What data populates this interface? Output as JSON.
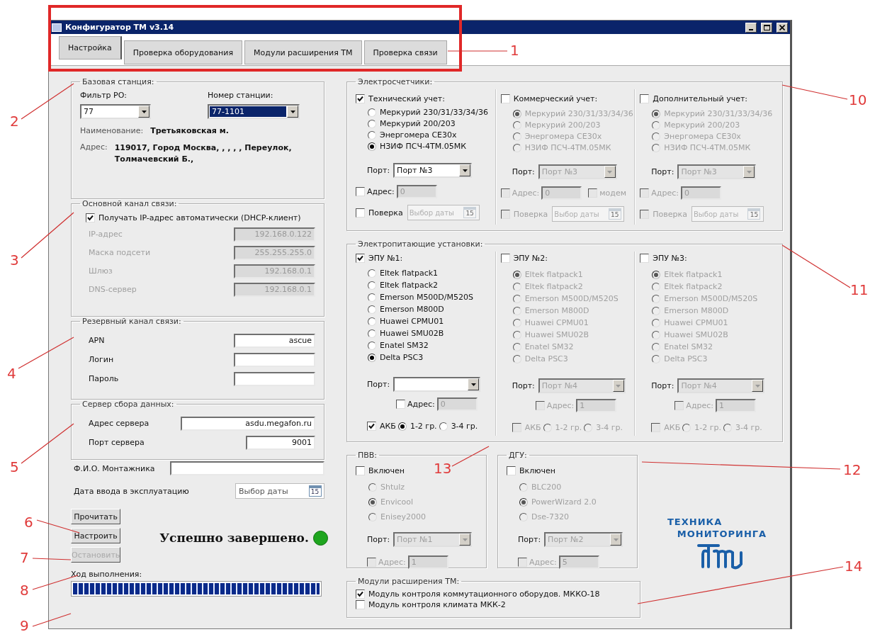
{
  "window": {
    "title": "Конфигуратор ТМ v3.14"
  },
  "tabs": [
    {
      "label": "Настройка",
      "selected": true
    },
    {
      "label": "Проверка оборудования",
      "selected": false
    },
    {
      "label": "Модули расширения ТМ",
      "selected": false
    },
    {
      "label": "Проверка связи",
      "selected": false
    }
  ],
  "base_station": {
    "title": "Базовая станция:",
    "filter_label": "Фильтр РО:",
    "filter_value": "77",
    "station_label": "Номер станции:",
    "station_value": "77-1101",
    "name_label": "Наименование:",
    "name_value": "Третьяковская м.",
    "address_label": "Адрес:",
    "address_value": "119017, Город Москва, , , , , Переулок, Толмачевский Б.,"
  },
  "main_channel": {
    "title": "Основной канал связи:",
    "dhcp": {
      "label": "Получать IP-адрес автоматически (DHCP-клиент)",
      "checked": true
    },
    "fields": [
      {
        "label": "IP-адрес",
        "value": "192.168.0.122"
      },
      {
        "label": "Маска подсети",
        "value": "255.255.255.0"
      },
      {
        "label": "Шлюз",
        "value": "192.168.0.1"
      },
      {
        "label": "DNS-сервер",
        "value": "192.168.0.1"
      }
    ]
  },
  "backup_channel": {
    "title": "Резервный канал связи:",
    "fields": [
      {
        "label": "APN",
        "value": "ascue"
      },
      {
        "label": "Логин"
      },
      {
        "label": "Пароль"
      }
    ]
  },
  "data_server": {
    "title": "Сервер сбора данных:",
    "fields": [
      {
        "label": "Адрес сервера",
        "value": "asdu.megafon.ru"
      },
      {
        "label": "Порт сервера",
        "value": "9001"
      }
    ]
  },
  "installer": {
    "label": "Ф.И.О. Монтажника"
  },
  "commission_date": {
    "label": "Дата ввода в эксплуатацию",
    "placeholder": "Выбор даты",
    "calendar_day": "15"
  },
  "buttons": [
    {
      "label": "Прочитать",
      "disabled": false
    },
    {
      "label": "Настроить",
      "disabled": false
    },
    {
      "label": "Остановить",
      "disabled": true
    }
  ],
  "status": {
    "text": "Успешно завершено."
  },
  "progress": {
    "label": "Ход выполнения:",
    "level": 1
  },
  "meters": {
    "title": "Электросчетчики:",
    "columns": [
      {
        "label": "Технический учет:",
        "checked": true,
        "options": [
          {
            "label": "Меркурий 230/31/33/34/36",
            "selected": false
          },
          {
            "label": "Меркурий 200/203",
            "selected": false
          },
          {
            "label": "Энергомера СЕ30х",
            "selected": false
          },
          {
            "label": "НЗИФ ПСЧ-4ТМ.05МК",
            "selected": true
          }
        ],
        "port_label": "Порт:",
        "port_value": "Порт №3",
        "address_label": "Адрес:",
        "address_checked": false,
        "address_value": "0",
        "verify_label": "Поверка",
        "verify_checked": false,
        "date_placeholder": "Выбор даты",
        "calendar_day": "15"
      },
      {
        "label": "Коммерческий учет:",
        "checked": false,
        "options": [
          {
            "label": "Меркурий 230/31/33/34/36",
            "selected": true
          },
          {
            "label": "Меркурий 200/203",
            "selected": false
          },
          {
            "label": "Энергомера СЕ30х",
            "selected": false
          },
          {
            "label": "НЗИФ ПСЧ-4ТМ.05МК",
            "selected": false
          }
        ],
        "port_label": "Порт:",
        "port_value": "Порт №3",
        "address_label": "Адрес:",
        "address_checked": false,
        "address_value": "0",
        "modem_label": "модем",
        "modem_checked": false,
        "verify_label": "Поверка",
        "verify_checked": false,
        "date_placeholder": "Выбор даты",
        "calendar_day": "15"
      },
      {
        "label": "Дополнительный учет:",
        "checked": false,
        "options": [
          {
            "label": "Меркурий 230/31/33/34/36",
            "selected": true
          },
          {
            "label": "Меркурий 200/203",
            "selected": false
          },
          {
            "label": "Энергомера СЕ30х",
            "selected": false
          },
          {
            "label": "НЗИФ ПСЧ-4ТМ.05МК",
            "selected": false
          }
        ],
        "port_label": "Порт:",
        "port_value": "Порт №3",
        "address_label": "Адрес:",
        "address_checked": false,
        "address_value": "0",
        "verify_label": "Поверка",
        "verify_checked": false,
        "date_placeholder": "Выбор даты",
        "calendar_day": "15"
      }
    ]
  },
  "power_units": {
    "title": "Электропитающие установки:",
    "columns": [
      {
        "label": "ЭПУ №1:",
        "checked": true,
        "options": [
          {
            "label": "Eltek flatpack1",
            "selected": false
          },
          {
            "label": "Eltek flatpack2",
            "selected": false
          },
          {
            "label": "Emerson M500D/M520S",
            "selected": false
          },
          {
            "label": "Emerson M800D",
            "selected": false
          },
          {
            "label": "Huawei CPMU01",
            "selected": false
          },
          {
            "label": "Huawei SMU02B",
            "selected": false
          },
          {
            "label": "Enatel SM32",
            "selected": false
          },
          {
            "label": "Delta PSC3",
            "selected": true
          }
        ],
        "port_label": "Порт:",
        "address_label": "Адрес:",
        "address_checked": false,
        "address_value": "0",
        "akb_label": "АКБ",
        "akb_checked": true,
        "groups": [
          {
            "label": "1-2 гр.",
            "selected": true
          },
          {
            "label": "3-4 гр.",
            "selected": false
          }
        ]
      },
      {
        "label": "ЭПУ №2:",
        "checked": false,
        "options": [
          {
            "label": "Eltek flatpack1",
            "selected": true
          },
          {
            "label": "Eltek flatpack2",
            "selected": false
          },
          {
            "label": "Emerson M500D/M520S",
            "selected": false
          },
          {
            "label": "Emerson M800D",
            "selected": false
          },
          {
            "label": "Huawei CPMU01",
            "selected": false
          },
          {
            "label": "Huawei SMU02B",
            "selected": false
          },
          {
            "label": "Enatel SM32",
            "selected": false
          },
          {
            "label": "Delta PSC3",
            "selected": false
          }
        ],
        "port_label": "Порт:",
        "port_value": "Порт №4",
        "address_label": "Адрес:",
        "address_checked": false,
        "address_value": "1",
        "akb_label": "АКБ",
        "akb_checked": false,
        "groups": [
          {
            "label": "1-2 гр.",
            "selected": false
          },
          {
            "label": "3-4 гр.",
            "selected": false
          }
        ]
      },
      {
        "label": "ЭПУ №3:",
        "checked": false,
        "options": [
          {
            "label": "Eltek flatpack1",
            "selected": true
          },
          {
            "label": "Eltek flatpack2",
            "selected": false
          },
          {
            "label": "Emerson M500D/M520S",
            "selected": false
          },
          {
            "label": "Emerson M800D",
            "selected": false
          },
          {
            "label": "Huawei CPMU01",
            "selected": false
          },
          {
            "label": "Huawei SMU02B",
            "selected": false
          },
          {
            "label": "Enatel SM32",
            "selected": false
          },
          {
            "label": "Delta PSC3",
            "selected": false
          }
        ],
        "port_label": "Порт:",
        "port_value": "Порт №4",
        "address_label": "Адрес:",
        "address_checked": false,
        "address_value": "1",
        "akb_label": "АКБ",
        "akb_checked": false,
        "groups": [
          {
            "label": "1-2 гр.",
            "selected": false
          },
          {
            "label": "3-4 гр.",
            "selected": false
          }
        ]
      }
    ]
  },
  "units": [
    {
      "title": "ПВВ:",
      "enabled_label": "Включен",
      "enabled_checked": false,
      "options": [
        {
          "label": "Shtulz",
          "selected": false
        },
        {
          "label": "Envicool",
          "selected": true
        },
        {
          "label": "Enisey2000",
          "selected": false
        }
      ],
      "port_label": "Порт:",
      "port_value": "Порт №1",
      "address_label": "Адрес:",
      "address_checked": false,
      "address_value": "1"
    },
    {
      "title": "ДГУ:",
      "enabled_label": "Включен",
      "enabled_checked": false,
      "options": [
        {
          "label": "BLC200",
          "selected": false
        },
        {
          "label": "PowerWizard 2.0",
          "selected": true
        },
        {
          "label": "Dse-7320",
          "selected": false
        }
      ],
      "port_label": "Порт:",
      "port_value": "Порт №2",
      "address_label": "Адрес:",
      "address_checked": false,
      "address_value": "5"
    }
  ],
  "modules": {
    "title": "Модули расширения ТМ:",
    "items": [
      {
        "label": "Модуль контроля коммутационного оборудов. МККО-18",
        "checked": true
      },
      {
        "label": "Модуль контроля климата МКК-2",
        "checked": false
      }
    ]
  },
  "logo": {
    "line_1": "ТЕХНИКА",
    "line_2": "МОНИТОРИНГА"
  },
  "annotations": [
    {
      "label": "1"
    },
    {
      "label": "2"
    },
    {
      "label": "3"
    },
    {
      "label": "4"
    },
    {
      "label": "5"
    },
    {
      "label": "6"
    },
    {
      "label": "7"
    },
    {
      "label": "8"
    },
    {
      "label": "9"
    },
    {
      "label": "10"
    },
    {
      "label": "11"
    },
    {
      "label": "13"
    },
    {
      "label": "12"
    },
    {
      "label": "14"
    }
  ]
}
